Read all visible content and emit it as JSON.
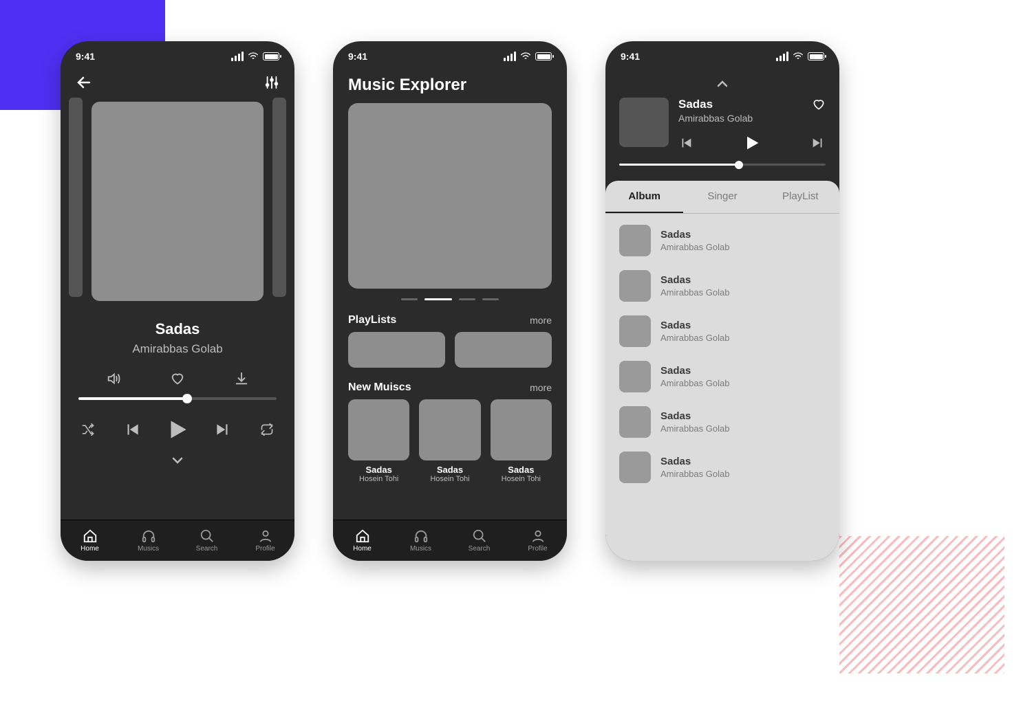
{
  "status_time": "9:41",
  "nav": {
    "home": "Home",
    "musics": "Musics",
    "search": "Search",
    "profile": "Profile"
  },
  "player": {
    "track_title": "Sadas",
    "track_artist": "Amirabbas Golab",
    "progress_pct": 55
  },
  "explorer": {
    "title": "Music Explorer",
    "sections": {
      "playlists": {
        "label": "PlayLists",
        "more": "more"
      },
      "newmusics": {
        "label": "New Muiscs",
        "more": "more"
      }
    },
    "new_musics": [
      {
        "title": "Sadas",
        "artist": "Hosein Tohi"
      },
      {
        "title": "Sadas",
        "artist": "Hosein Tohi"
      },
      {
        "title": "Sadas",
        "artist": "Hosein Tohi"
      }
    ]
  },
  "mini": {
    "title": "Sadas",
    "artist": "Amirabbas Golab",
    "progress_pct": 58,
    "tabs": {
      "album": "Album",
      "singer": "Singer",
      "playlist": "PlayList"
    },
    "list": [
      {
        "title": "Sadas",
        "artist": "Amirabbas Golab"
      },
      {
        "title": "Sadas",
        "artist": "Amirabbas Golab"
      },
      {
        "title": "Sadas",
        "artist": "Amirabbas Golab"
      },
      {
        "title": "Sadas",
        "artist": "Amirabbas Golab"
      },
      {
        "title": "Sadas",
        "artist": "Amirabbas Golab"
      },
      {
        "title": "Sadas",
        "artist": "Amirabbas Golab"
      }
    ]
  }
}
